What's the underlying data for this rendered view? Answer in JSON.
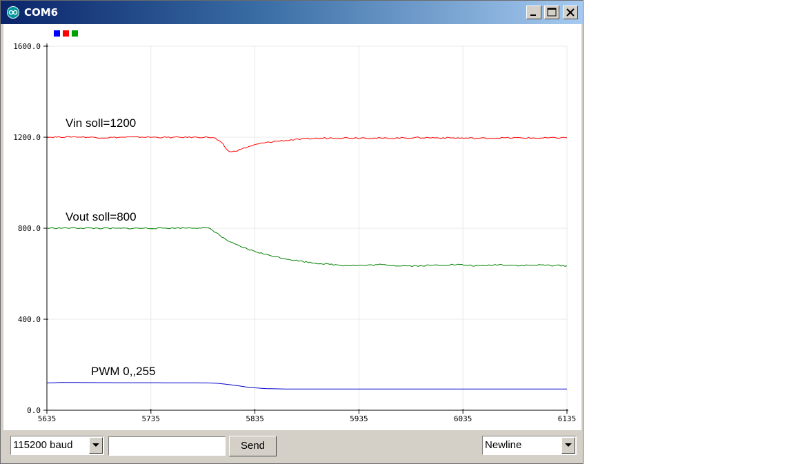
{
  "window": {
    "title": "COM6",
    "controls": [
      "minimize-icon",
      "maximize-icon",
      "close-icon"
    ],
    "title_gradient": [
      "#0a246a",
      "#a6caf0"
    ]
  },
  "legend": {
    "swatches": [
      {
        "color": "#0000ff"
      },
      {
        "color": "#ff0000"
      },
      {
        "color": "#00a000"
      }
    ]
  },
  "annotations": {
    "vin": "Vin soll=1200",
    "vout": "Vout soll=800",
    "pwm": "PWM 0,,255"
  },
  "chart_data": {
    "type": "line",
    "xlim": [
      5635,
      6135
    ],
    "ylim": [
      0,
      1600
    ],
    "x_ticks": [
      "5635",
      "5735",
      "5835",
      "5935",
      "6035",
      "6135"
    ],
    "y_ticks": [
      "0.0",
      "400.0",
      "800.0",
      "1200.0",
      "1600.0"
    ],
    "grid": true,
    "legend": "top-left",
    "series": [
      {
        "color": "#0000cc",
        "points": [
          [
            5635,
            120
          ],
          [
            5650,
            122
          ],
          [
            5700,
            121
          ],
          [
            5730,
            121
          ],
          [
            5790,
            120
          ],
          [
            5800,
            118
          ],
          [
            5815,
            110
          ],
          [
            5830,
            100
          ],
          [
            5845,
            95
          ],
          [
            5870,
            93
          ],
          [
            5900,
            93
          ],
          [
            5950,
            93
          ],
          [
            6000,
            93
          ],
          [
            6050,
            93
          ],
          [
            6100,
            93
          ],
          [
            6135,
            93
          ]
        ]
      },
      {
        "color": "#ff0000",
        "points": [
          [
            5635,
            1200
          ],
          [
            5660,
            1202
          ],
          [
            5690,
            1198
          ],
          [
            5720,
            1201
          ],
          [
            5750,
            1199
          ],
          [
            5790,
            1200
          ],
          [
            5797,
            1195
          ],
          [
            5804,
            1170
          ],
          [
            5809,
            1140
          ],
          [
            5813,
            1135
          ],
          [
            5820,
            1145
          ],
          [
            5830,
            1160
          ],
          [
            5840,
            1172
          ],
          [
            5855,
            1182
          ],
          [
            5870,
            1188
          ],
          [
            5890,
            1194
          ],
          [
            5910,
            1197
          ],
          [
            5940,
            1197
          ],
          [
            5960,
            1195
          ],
          [
            5990,
            1198
          ],
          [
            6020,
            1197
          ],
          [
            6050,
            1195
          ],
          [
            6080,
            1197
          ],
          [
            6110,
            1196
          ],
          [
            6135,
            1198
          ]
        ]
      },
      {
        "color": "#008000",
        "points": [
          [
            5635,
            800
          ],
          [
            5660,
            801
          ],
          [
            5700,
            799
          ],
          [
            5740,
            800
          ],
          [
            5785,
            802
          ],
          [
            5792,
            798
          ],
          [
            5798,
            780
          ],
          [
            5805,
            755
          ],
          [
            5815,
            730
          ],
          [
            5830,
            705
          ],
          [
            5845,
            685
          ],
          [
            5860,
            670
          ],
          [
            5875,
            658
          ],
          [
            5890,
            648
          ],
          [
            5905,
            642
          ],
          [
            5920,
            637
          ],
          [
            5940,
            636
          ],
          [
            5955,
            640
          ],
          [
            5970,
            636
          ],
          [
            5990,
            634
          ],
          [
            6010,
            638
          ],
          [
            6030,
            640
          ],
          [
            6050,
            634
          ],
          [
            6070,
            640
          ],
          [
            6090,
            636
          ],
          [
            6110,
            638
          ],
          [
            6135,
            635
          ]
        ]
      }
    ]
  },
  "bottom_bar": {
    "baud_value": "115200 baud",
    "send_input_value": "",
    "send_label": "Send",
    "line_ending_value": "Newline"
  }
}
